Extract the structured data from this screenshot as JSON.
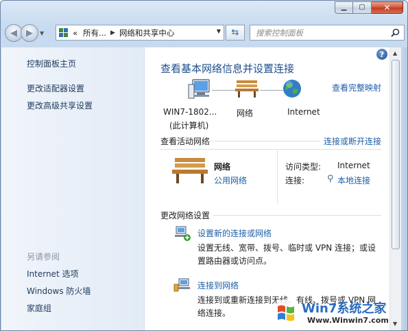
{
  "window": {
    "minimize_icon": "minimize-icon",
    "maximize_icon": "maximize-icon",
    "close_icon": "close-icon"
  },
  "nav": {
    "back_icon": "back-arrow-icon",
    "forward_icon": "forward-arrow-icon",
    "breadcrumb_root": "«",
    "breadcrumb_all": "所有...",
    "breadcrumb_current": "网络和共享中心",
    "search_placeholder": "搜索控制面板"
  },
  "sidebar": {
    "items": [
      {
        "label": "控制面板主页"
      },
      {
        "label": "更改适配器设置"
      },
      {
        "label": "更改高级共享设置"
      }
    ],
    "see_also_heading": "另请参阅",
    "see_also": [
      {
        "label": "Internet 选项"
      },
      {
        "label": "Windows 防火墙"
      },
      {
        "label": "家庭组"
      }
    ]
  },
  "main": {
    "title": "查看基本网络信息并设置连接",
    "view_full_map": "查看完整映射",
    "map": {
      "computer_name": "WIN7-1802...",
      "computer_note": "(此计算机)",
      "network": "网络",
      "internet": "Internet"
    },
    "active_networks_heading": "查看活动网络",
    "connect_disconnect": "连接或断开连接",
    "active": {
      "name": "网络",
      "type": "公用网络",
      "access_type_label": "访问类型:",
      "access_type_value": "Internet",
      "connection_label": "连接:",
      "connection_value": "本地连接"
    },
    "change_settings_heading": "更改网络设置",
    "tasks": [
      {
        "title": "设置新的连接或网络",
        "desc_line1": "设置无线、宽带、拨号、临时或 VPN 连接；或设",
        "desc_line2": "置路由器或访问点。"
      },
      {
        "title": "连接到网络",
        "desc_line1": "连接到或重新连接到无线、有线、拨号或 VPN 网",
        "desc_line2": "络连接。"
      }
    ]
  },
  "watermark": {
    "brand": "Win7系统之家",
    "url": "Www.Winwin7.com"
  },
  "colors": {
    "link": "#1c5fa8",
    "title": "#1e4e8c",
    "sidebar_bg": "#e8eff8",
    "close_red": "#c23a1f"
  }
}
